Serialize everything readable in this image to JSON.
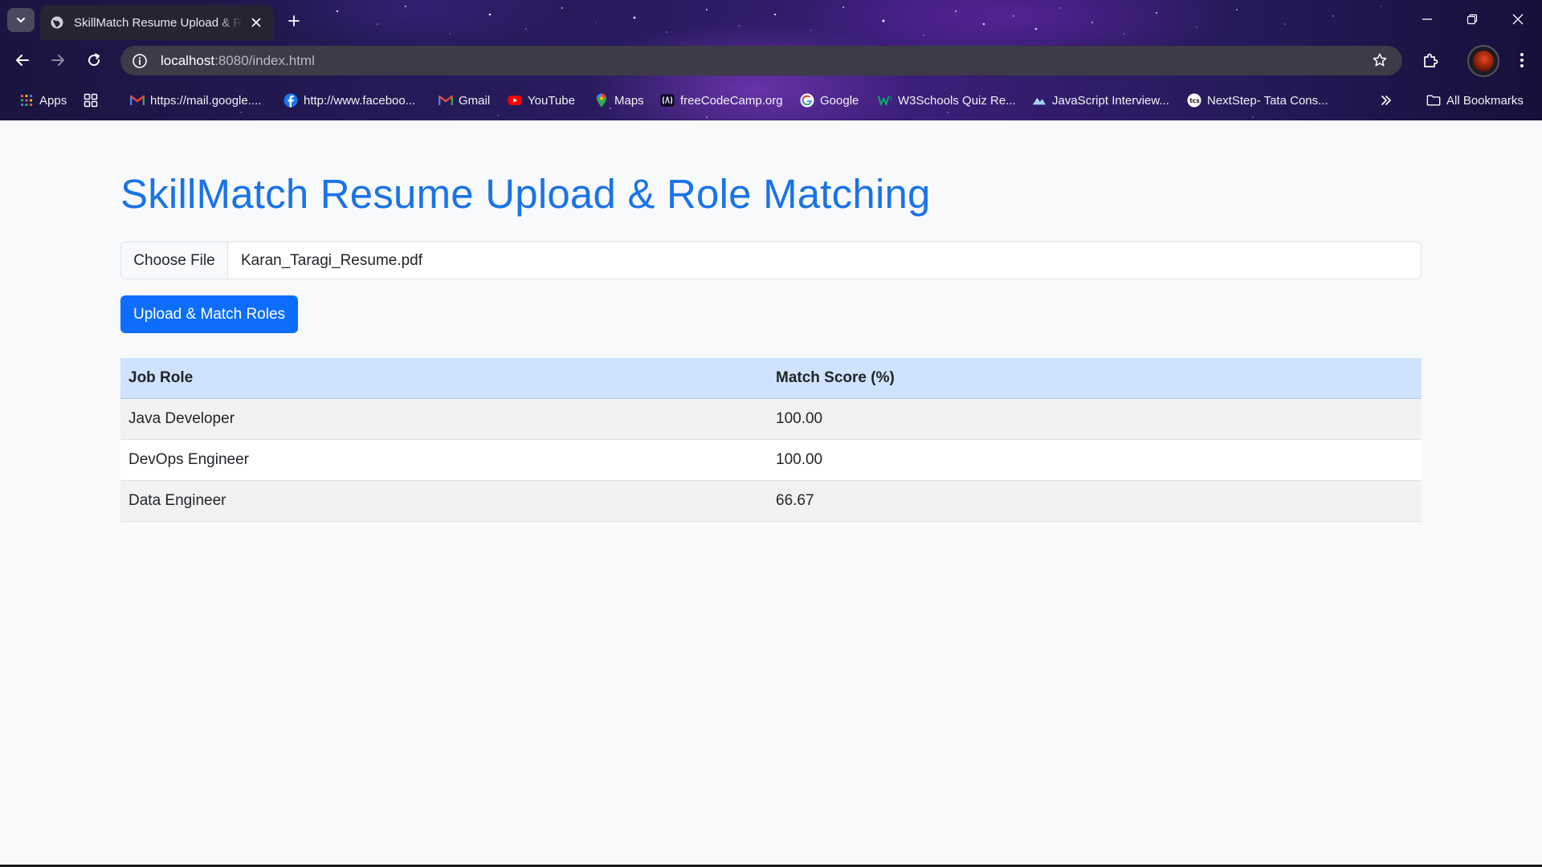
{
  "browser": {
    "tab": {
      "title": "SkillMatch Resume Upload & Role Matching"
    },
    "address": {
      "host": "localhost",
      "rest": ":8080/index.html"
    },
    "bookmarks": [
      {
        "label": "Apps",
        "icon": "apps-grid-icon"
      },
      {
        "label": "",
        "icon": "tab-groups-icon"
      },
      {
        "label": "https://mail.google....",
        "icon": "gmail-icon"
      },
      {
        "label": "http://www.faceboo...",
        "icon": "facebook-icon"
      },
      {
        "label": "Gmail",
        "icon": "gmail-icon"
      },
      {
        "label": "YouTube",
        "icon": "youtube-icon"
      },
      {
        "label": "Maps",
        "icon": "maps-pin-icon"
      },
      {
        "label": "freeCodeCamp.org",
        "icon": "freecodecamp-icon"
      },
      {
        "label": "Google",
        "icon": "google-icon"
      },
      {
        "label": "W3Schools Quiz Re...",
        "icon": "w3schools-icon"
      },
      {
        "label": "JavaScript Interview...",
        "icon": "mountain-icon"
      },
      {
        "label": "NextStep- Tata Cons...",
        "icon": "tcs-icon"
      }
    ],
    "all_bookmarks_label": "All Bookmarks"
  },
  "page": {
    "title": "SkillMatch Resume Upload & Role Matching",
    "file_button_label": "Choose File",
    "file_name": "Karan_Taragi_Resume.pdf",
    "upload_button_label": "Upload & Match Roles",
    "table": {
      "headers": [
        "Job Role",
        "Match Score (%)"
      ],
      "rows": [
        [
          "Java Developer",
          "100.00"
        ],
        [
          "DevOps Engineer",
          "100.00"
        ],
        [
          "Data Engineer",
          "66.67"
        ]
      ]
    }
  },
  "colors": {
    "accent": "#1a73e8",
    "button": "#0d6efd",
    "table_header": "#cfe2ff"
  }
}
